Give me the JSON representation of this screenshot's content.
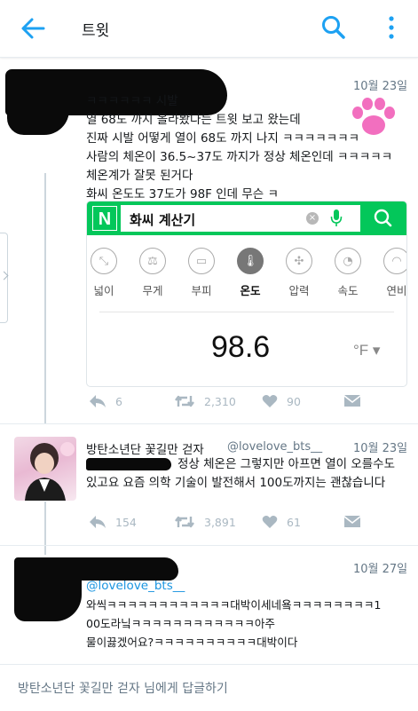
{
  "header": {
    "title": "트윗"
  },
  "tweets": [
    {
      "date": "10월 23일",
      "lines": [
        "ㅋㅋㅋㅋㅋㅋ 시발",
        "열 68도 까지 올라봤다는 트윗 보고 왔는데",
        "진짜 시발 어떻게 열이 68도 까지 나지 ㅋㅋㅋㅋㅋㅋㅋ",
        "사람의 체온이 36.5~37도 까지가 정상 체온인데 ㅋㅋㅋㅋㅋ",
        "체온계가 잘못 된거다",
        "화씨 온도도 37도가 98F 인데 무슨 ㅋ"
      ],
      "card": {
        "logo": "N",
        "query": "화씨 계산기",
        "clear": "×",
        "units": [
          "넓이",
          "무게",
          "부피",
          "온도",
          "압력",
          "속도",
          "연비"
        ],
        "active_unit": "온도",
        "value": "98.6",
        "unit_select": "°F ▾"
      },
      "stats": {
        "replies": "6",
        "retweets": "2,310",
        "likes": "90"
      }
    },
    {
      "name": "방탄소년단 꽃길만 걷자",
      "handle": "@lovelove_bts__",
      "date": "10월 23일",
      "lines": [
        "정상 체온은 그렇지만 아프면 열이 오를수도",
        "있고요 요즘 의학 기술이 발전해서 100도까지는 괜찮습니다"
      ],
      "stats": {
        "replies": "154",
        "retweets": "3,891",
        "likes": "61"
      }
    },
    {
      "date": "10월 27일",
      "mention": "@lovelove_bts__",
      "lines": [
        "와씩ㅋㅋㅋㅋㅋㅋㅋㅋㅋㅋㅋㅋ대박이세네욬ㅋㅋㅋㅋㅋㅋㅋㅋ1",
        "00도라닠ㅋㅋㅋㅋㅋㅋㅋㅋㅋㅋㅋㅋ아주",
        "물이끓겠어요?ㅋㅋㅋㅋㅋㅋㅋㅋㅋㅋ대박이다"
      ]
    }
  ],
  "reply_placeholder": "방탄소년단 꽃길만 걷자 님에게 답글하기",
  "colors": {
    "accent": "#1da1f2",
    "naver_green": "#03c75a",
    "muted": "#aab8c2"
  }
}
